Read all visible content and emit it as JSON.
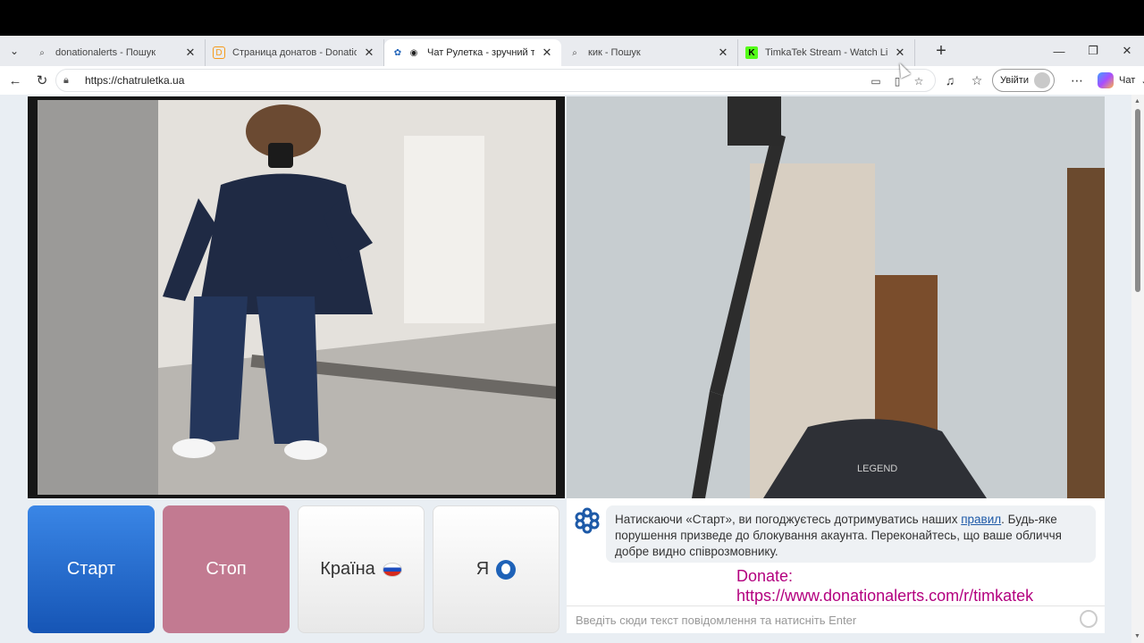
{
  "browser": {
    "tabs": [
      {
        "title": "donationalerts - Пошук",
        "favicon": "search-icon"
      },
      {
        "title": "Страница донатов - DonationAlerts",
        "favicon": "donationalerts-icon"
      },
      {
        "title": "Чат Рулетка - зручний та безпечний",
        "favicon": "chatruletka-icon"
      },
      {
        "title": "кик - Пошук",
        "favicon": "search-icon"
      },
      {
        "title": "TimkaTek Stream - Watch Live on Kick",
        "favicon": "kick-icon"
      }
    ],
    "url": "https://chatruletka.ua",
    "signin_label": "Увійти",
    "copilot_label": "Чат"
  },
  "controls": {
    "start_label": "Старт",
    "stop_label": "Стоп",
    "country_label": "Країна",
    "me_label": "Я"
  },
  "chat": {
    "notice_before_link": "Натискаючи «Старт», ви погоджуєтесь дотримуватись наших ",
    "notice_link": "правил",
    "notice_after_link": ". Будь-яке порушення призведе до блокування акаунта. Переконайтесь, що ваше обличчя добре видно співрозмовнику.",
    "donate_line1": "Donate:",
    "donate_line2": "https://www.donationalerts.com/r/timkatek",
    "input_placeholder": "Введіть сюди текст повідомлення та натисніть Enter"
  },
  "colors": {
    "start": "#1e64c8",
    "stop": "#c27a91",
    "donate": "#b3007f",
    "link": "#1e5aa8"
  }
}
